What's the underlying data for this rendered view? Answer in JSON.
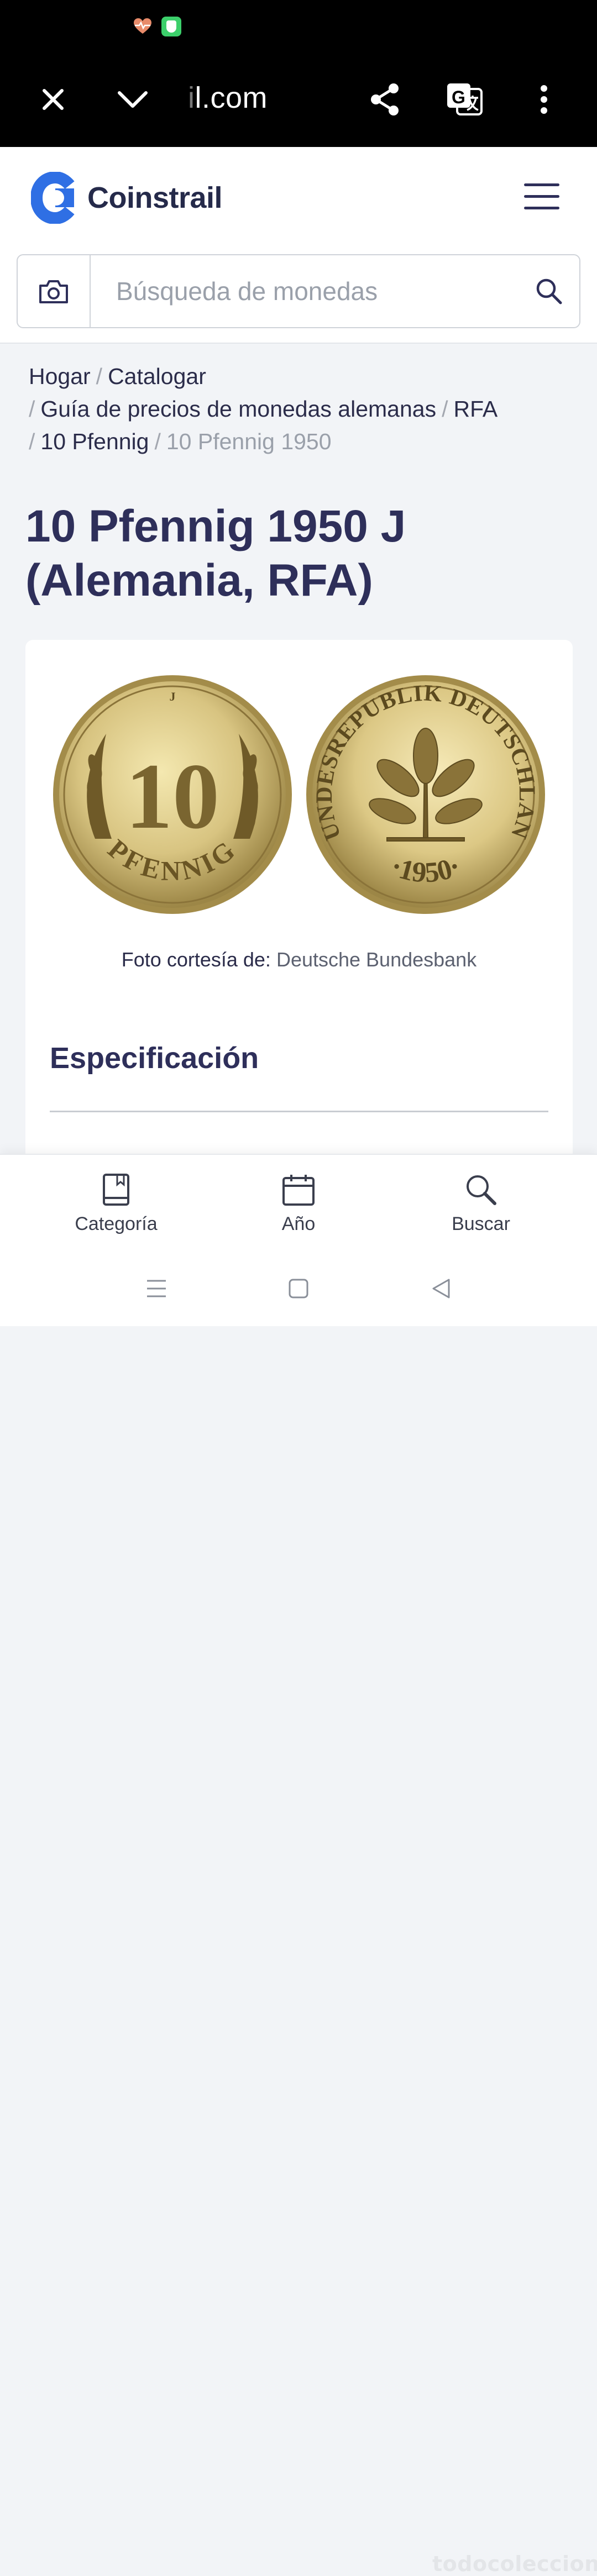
{
  "browser": {
    "url_faded": "i",
    "url_visible": "l.com"
  },
  "site": {
    "brand": "Coinstrail",
    "brand_color": "#2f6fe4",
    "search_placeholder": "Búsqueda de monedas"
  },
  "breadcrumb": {
    "items": [
      "Hogar",
      "Catalogar",
      "Guía de precios de monedas alemanas",
      "RFA",
      "10 Pfennig"
    ],
    "current": "10 Pfennig 1950",
    "separator": "/"
  },
  "page": {
    "title": "10 Pfennig 1950 J (Alemania, RFA)"
  },
  "coin": {
    "obverse_value": "10",
    "obverse_denomination": "PFENNIG",
    "mint_mark": "J",
    "reverse_legend": "BUNDESREPUBLIK DEUTSCHLAND",
    "reverse_year": "·1950·",
    "caption_label": "Foto cortesía de:",
    "caption_source": "Deutsche Bundesbank"
  },
  "section": {
    "spec_title": "Especificación"
  },
  "bottom_nav": [
    {
      "label": "Categoría",
      "icon": "book-icon"
    },
    {
      "label": "Año",
      "icon": "calendar-icon"
    },
    {
      "label": "Buscar",
      "icon": "search-icon"
    }
  ],
  "watermark": "todocoleccion"
}
